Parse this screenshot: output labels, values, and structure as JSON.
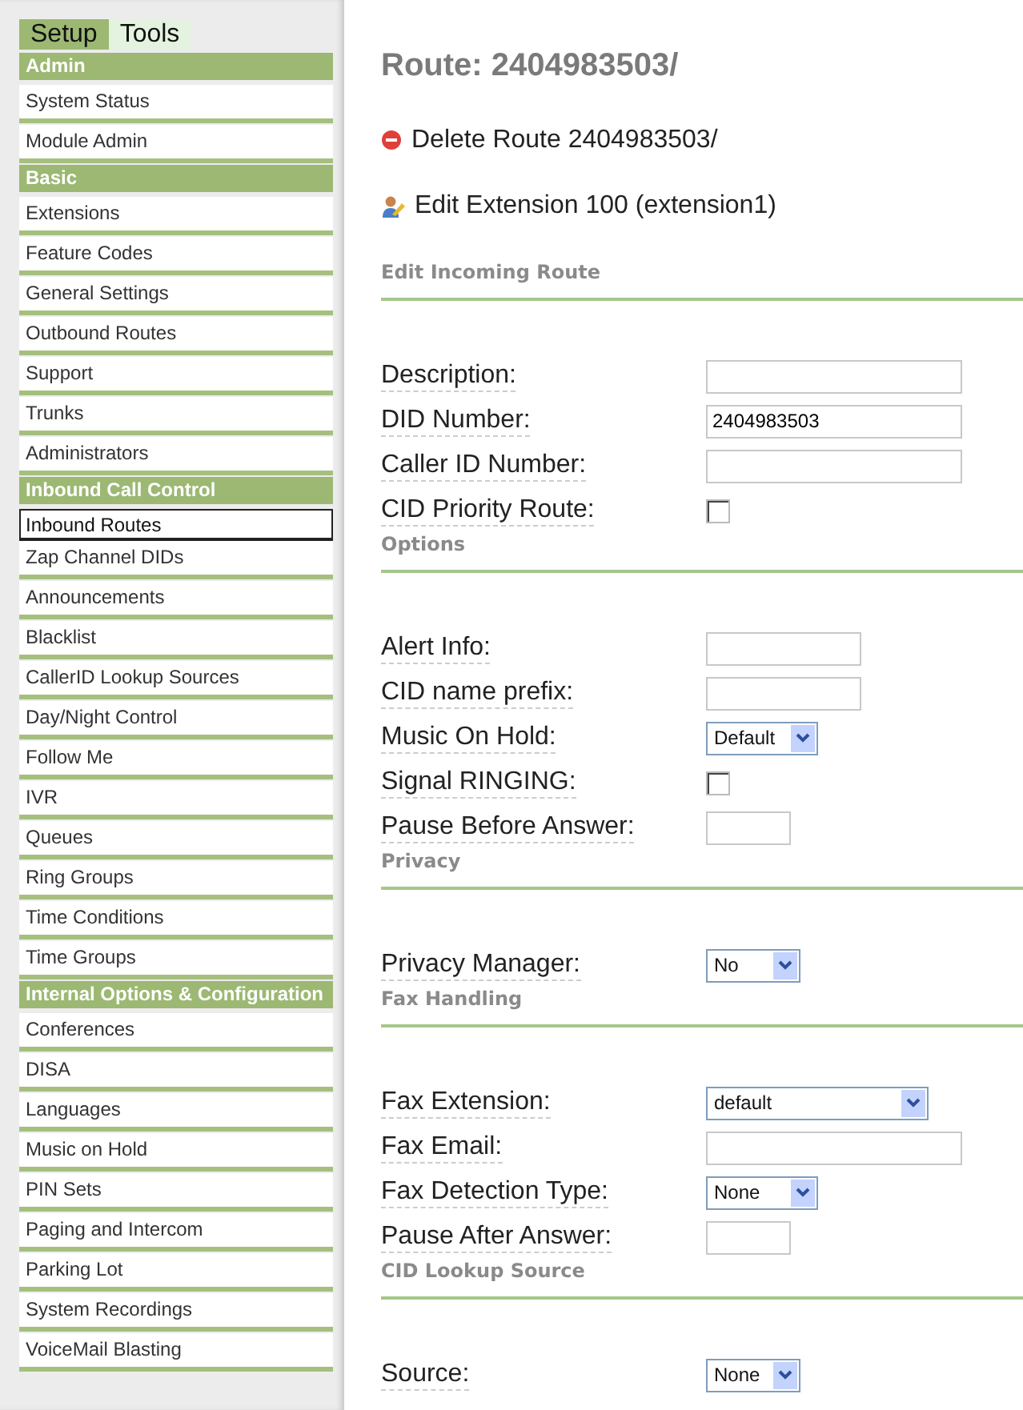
{
  "sidebar": {
    "tabs": [
      {
        "label": "Setup",
        "selected": true
      },
      {
        "label": "Tools",
        "selected": false
      }
    ],
    "items": [
      {
        "kind": "header",
        "label": "Admin"
      },
      {
        "kind": "link",
        "label": "System Status",
        "selected": false
      },
      {
        "kind": "link",
        "label": "Module Admin",
        "selected": false
      },
      {
        "kind": "header",
        "label": "Basic"
      },
      {
        "kind": "link",
        "label": "Extensions",
        "selected": false
      },
      {
        "kind": "link",
        "label": "Feature Codes",
        "selected": false
      },
      {
        "kind": "link",
        "label": "General Settings",
        "selected": false
      },
      {
        "kind": "link",
        "label": "Outbound Routes",
        "selected": false
      },
      {
        "kind": "link",
        "label": "Support",
        "selected": false
      },
      {
        "kind": "link",
        "label": "Trunks",
        "selected": false
      },
      {
        "kind": "link",
        "label": "Administrators",
        "selected": false
      },
      {
        "kind": "header",
        "label": "Inbound Call Control"
      },
      {
        "kind": "link",
        "label": "Inbound Routes",
        "selected": true
      },
      {
        "kind": "link",
        "label": "Zap Channel DIDs",
        "selected": false
      },
      {
        "kind": "link",
        "label": "Announcements",
        "selected": false
      },
      {
        "kind": "link",
        "label": "Blacklist",
        "selected": false
      },
      {
        "kind": "link",
        "label": "CallerID Lookup Sources",
        "selected": false
      },
      {
        "kind": "link",
        "label": "Day/Night Control",
        "selected": false
      },
      {
        "kind": "link",
        "label": "Follow Me",
        "selected": false
      },
      {
        "kind": "link",
        "label": "IVR",
        "selected": false
      },
      {
        "kind": "link",
        "label": "Queues",
        "selected": false
      },
      {
        "kind": "link",
        "label": "Ring Groups",
        "selected": false
      },
      {
        "kind": "link",
        "label": "Time Conditions",
        "selected": false
      },
      {
        "kind": "link",
        "label": "Time Groups",
        "selected": false
      },
      {
        "kind": "header",
        "label": "Internal Options & Configuration"
      },
      {
        "kind": "link",
        "label": "Conferences",
        "selected": false
      },
      {
        "kind": "link",
        "label": "DISA",
        "selected": false
      },
      {
        "kind": "link",
        "label": "Languages",
        "selected": false
      },
      {
        "kind": "link",
        "label": "Music on Hold",
        "selected": false
      },
      {
        "kind": "link",
        "label": "PIN Sets",
        "selected": false
      },
      {
        "kind": "link",
        "label": "Paging and Intercom",
        "selected": false
      },
      {
        "kind": "link",
        "label": "Parking Lot",
        "selected": false
      },
      {
        "kind": "link",
        "label": "System Recordings",
        "selected": false
      },
      {
        "kind": "link",
        "label": "VoiceMail Blasting",
        "selected": false
      }
    ]
  },
  "main": {
    "title": "Route: 2404983503/",
    "actions": [
      {
        "kind": "delete",
        "label": "Delete Route 2404983503/"
      },
      {
        "kind": "edit",
        "label": "Edit Extension 100 (extension1)"
      }
    ],
    "sections": [
      {
        "title": "Edit Incoming Route",
        "fields": [
          {
            "kind": "longtext",
            "label": "Description:"
          },
          {
            "kind": "longtext",
            "label": "DID Number:",
            "value": "2404983503"
          },
          {
            "kind": "longtext",
            "label": "Caller ID Number:"
          },
          {
            "kind": "checkbox",
            "label": "CID Priority Route:",
            "checked": false
          }
        ]
      },
      {
        "title": "Options",
        "fields": [
          {
            "kind": "text",
            "label": "Alert Info:"
          },
          {
            "kind": "text",
            "label": "CID name prefix:"
          },
          {
            "kind": "select",
            "label": "Music On Hold:",
            "value": "Default"
          },
          {
            "kind": "checkbox",
            "label": "Signal RINGING:",
            "checked": false
          },
          {
            "kind": "shorttext",
            "label": "Pause Before Answer:"
          }
        ]
      },
      {
        "title": "Privacy",
        "fields": [
          {
            "kind": "shortselect",
            "label": "Privacy Manager:",
            "value": "No"
          }
        ]
      },
      {
        "title": "Fax Handling",
        "fields": [
          {
            "kind": "longselect",
            "label": "Fax Extension:",
            "value": "default"
          },
          {
            "kind": "longtext",
            "label": "Fax Email:"
          },
          {
            "kind": "select",
            "label": "Fax Detection Type:",
            "value": "None"
          },
          {
            "kind": "shorttext",
            "label": "Pause After Answer:"
          }
        ]
      },
      {
        "title": "CID Lookup Source",
        "fields": [
          {
            "kind": "shortselect",
            "label": "Source:",
            "value": "None"
          }
        ]
      }
    ]
  }
}
